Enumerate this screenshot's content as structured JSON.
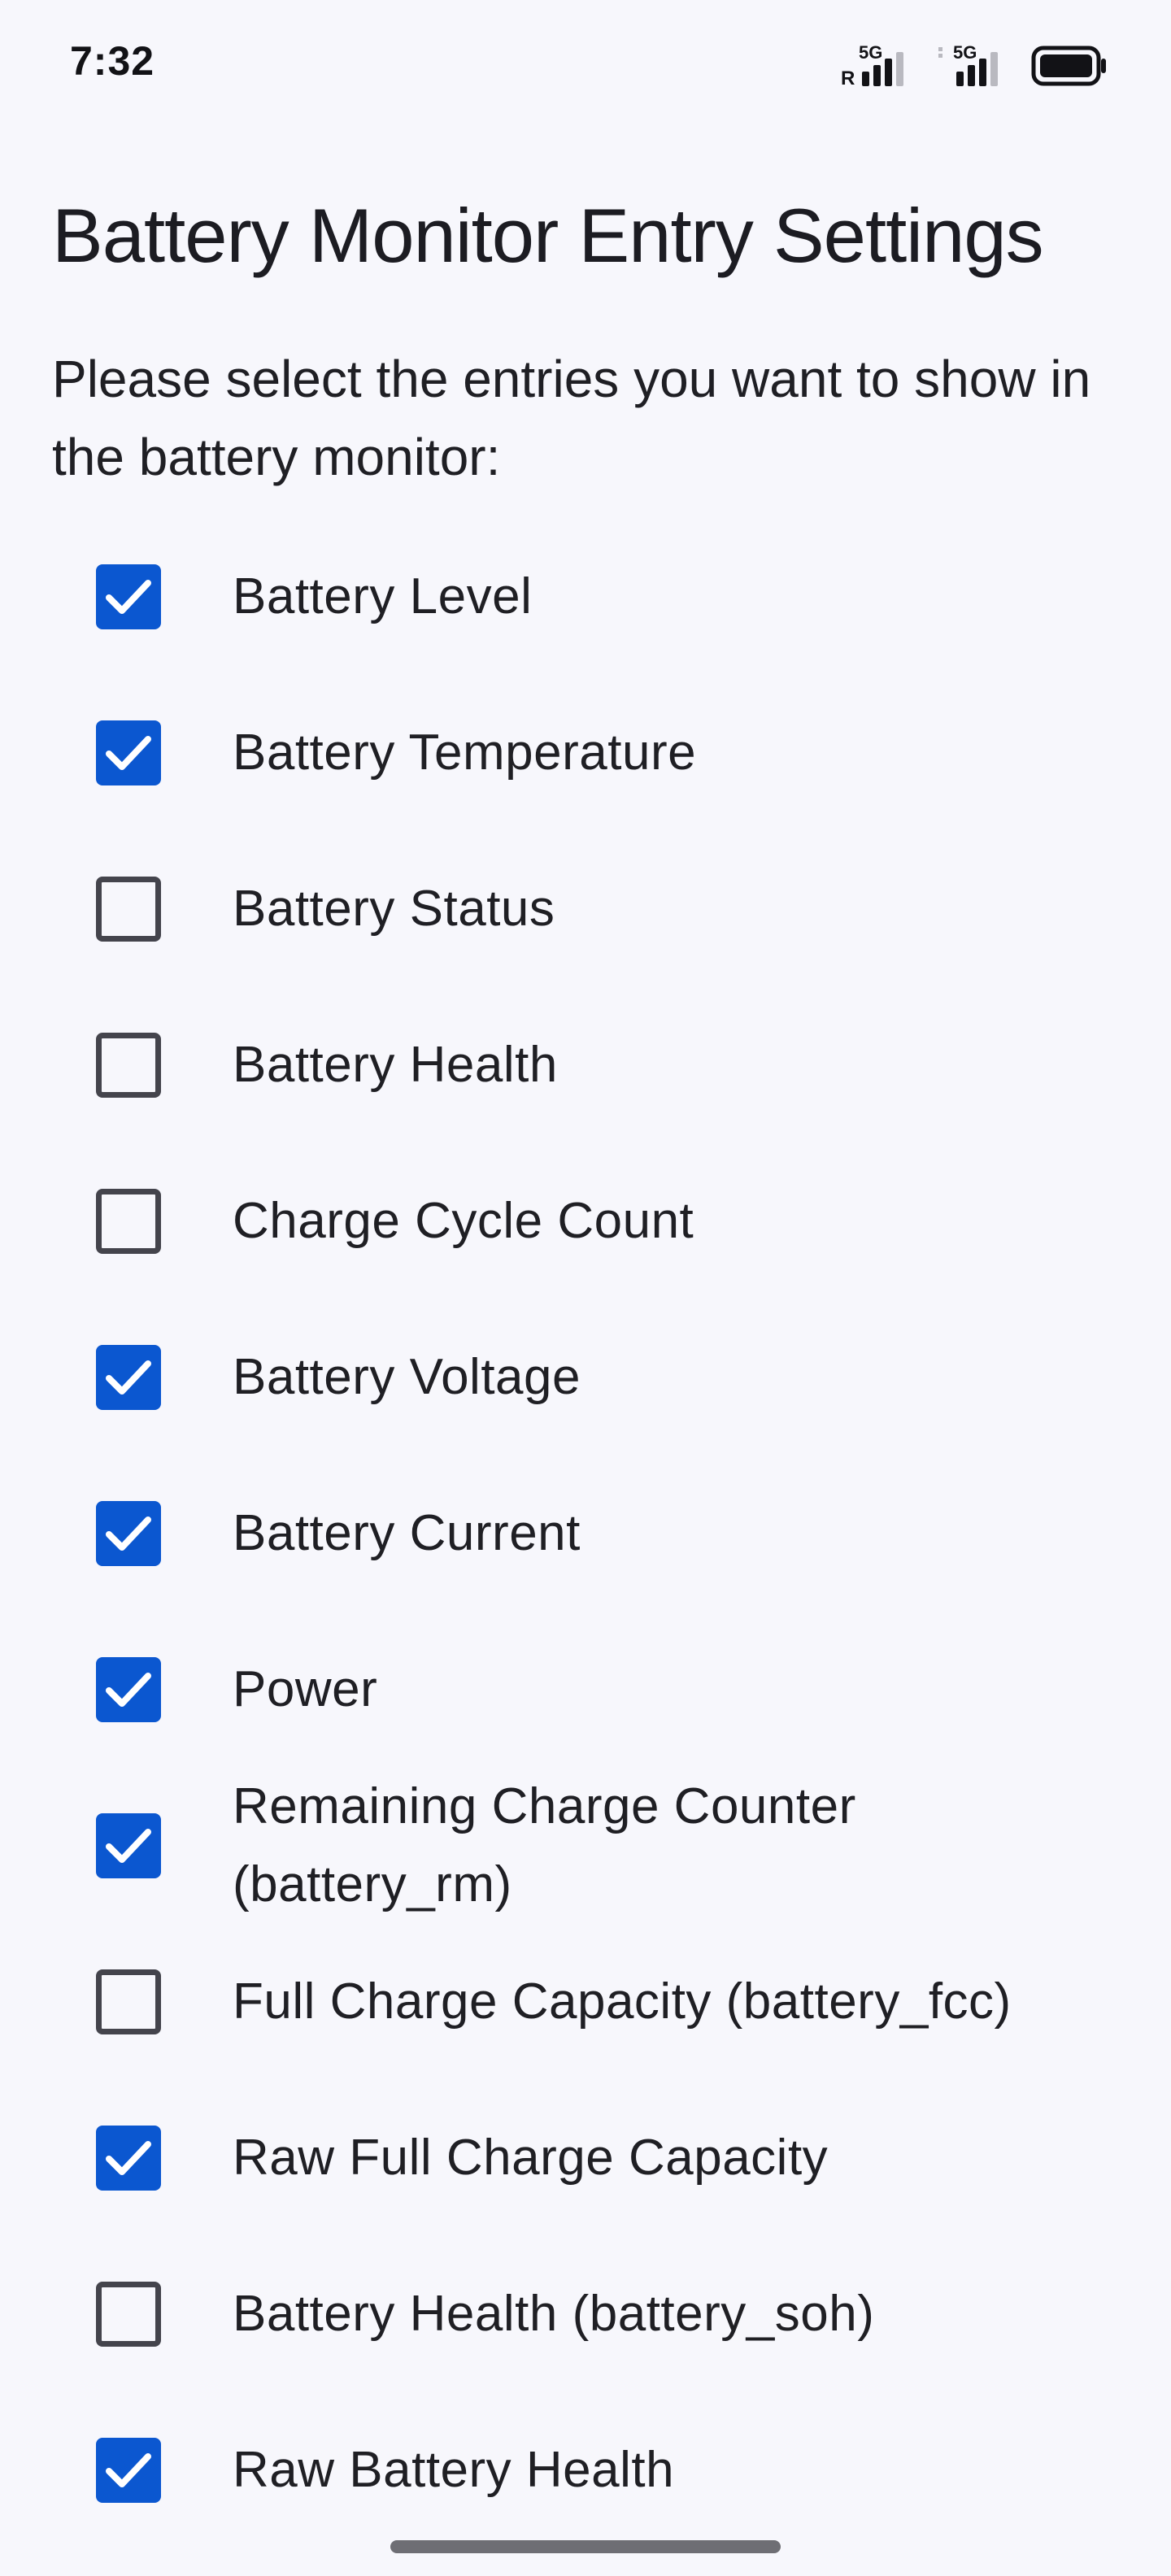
{
  "status_bar": {
    "time": "7:32",
    "sim1_network": "5G",
    "sim1_roaming": "R",
    "sim2_network": "5G",
    "icons": [
      "signal-5g-roaming-icon",
      "signal-5g-icon",
      "battery-icon"
    ]
  },
  "page": {
    "title": "Battery Monitor Entry Settings",
    "description": "Please select the entries you want to show in the battery monitor:"
  },
  "entries": [
    {
      "label": "Battery Level",
      "checked": true
    },
    {
      "label": "Battery Temperature",
      "checked": true
    },
    {
      "label": "Battery Status",
      "checked": false
    },
    {
      "label": "Battery Health",
      "checked": false
    },
    {
      "label": "Charge Cycle Count",
      "checked": false
    },
    {
      "label": "Battery Voltage",
      "checked": true
    },
    {
      "label": "Battery Current",
      "checked": true
    },
    {
      "label": "Power",
      "checked": true
    },
    {
      "label": "Remaining Charge Counter (battery_rm)",
      "checked": true
    },
    {
      "label": "Full Charge Capacity (battery_fcc)",
      "checked": false
    },
    {
      "label": "Raw Full Charge Capacity",
      "checked": true
    },
    {
      "label": "Battery Health (battery_soh)",
      "checked": false
    },
    {
      "label": "Raw Battery Health",
      "checked": true
    }
  ],
  "colors": {
    "background": "#f7f7fc",
    "checkbox_checked": "#0b57d0",
    "checkbox_unchecked_border": "#44444c",
    "text": "#1f1f24"
  }
}
